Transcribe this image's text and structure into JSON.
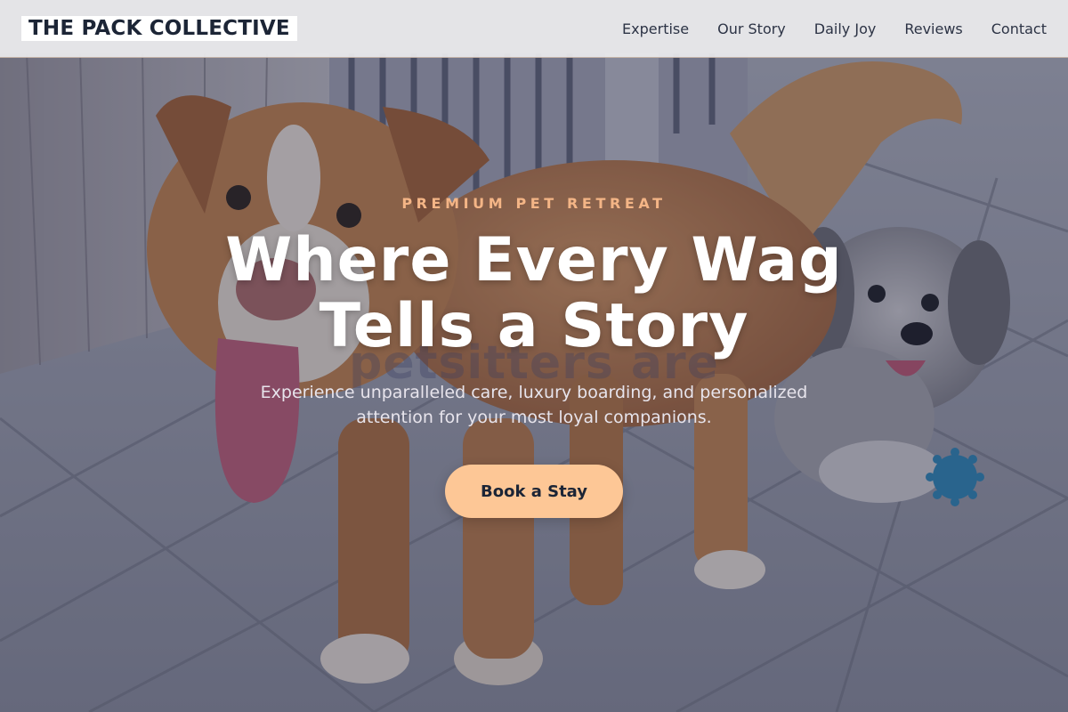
{
  "header": {
    "logo": "THE PACK COLLECTIVE",
    "nav": [
      {
        "label": "Expertise"
      },
      {
        "label": "Our Story"
      },
      {
        "label": "Daily Joy"
      },
      {
        "label": "Reviews"
      },
      {
        "label": "Contact"
      }
    ]
  },
  "hero": {
    "eyebrow": "PREMIUM PET RETREAT",
    "title_line1": "Where Every Wag",
    "title_line2": "Tells a Story",
    "ghost_text": "petsitters are",
    "subtitle_line1": "Experience unparalleled care, luxury boarding, and personalized",
    "subtitle_line2": "attention for your most loyal companions.",
    "cta_label": "Book a Stay"
  },
  "colors": {
    "accent": "#fdc796",
    "eyebrow": "#f4b586",
    "dark_text": "#1c2536",
    "overlay": "#262c48"
  },
  "icons": {
    "hero_image": "dogs-on-tiled-patio-photo"
  }
}
